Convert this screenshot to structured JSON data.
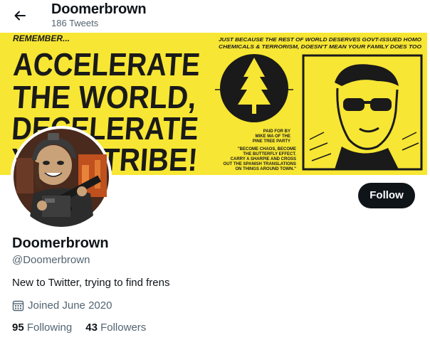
{
  "header": {
    "back_icon": "arrow-left-icon",
    "display_name": "Doomerbrown",
    "tweet_count": "186 Tweets"
  },
  "banner": {
    "remember": "REMEMBER...",
    "headline_lines": [
      "ACCELERATE",
      "THE WORLD,",
      "DECELERATE",
      "YOUR TRIBE!"
    ],
    "top_right_text_lines": [
      "JUST BECAUSE THE REST OF WORLD DESERVES GOVT-ISSUED HOMO",
      "CHEMICALS & TERRORISM, DOESN'T MEAN YOUR FAMILY DOES TOO"
    ],
    "paid_for_lines": [
      "PAID FOR BY",
      "MIKE MA OF THE",
      "PINE TREE PARTY"
    ],
    "quote_lines": [
      "\"BECOME CHAOS, BECOME",
      "THE BUTTERFLY EFFECT.",
      "CARRY A SHARPIE AND CROSS",
      "OUT THE SPANISH TRANSLATIONS",
      "ON THINGS AROUND TOWN.\""
    ],
    "background_color": "#f7e633"
  },
  "avatar": {
    "alt": "profile-photo"
  },
  "profile": {
    "follow_label": "Follow",
    "name": "Doomerbrown",
    "handle": "@Doomerbrown",
    "bio": "New to Twitter, trying to find frens",
    "joined_icon": "calendar-icon",
    "joined": "Joined June 2020",
    "following_count": "95",
    "following_label": "Following",
    "followers_count": "43",
    "followers_label": "Followers"
  }
}
